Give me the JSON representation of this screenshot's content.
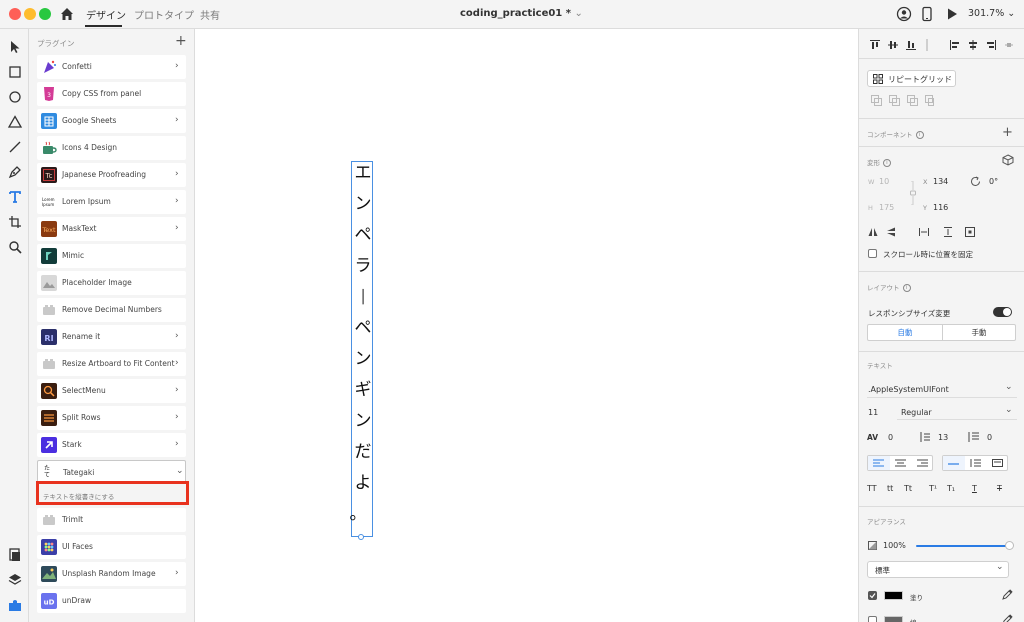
{
  "titlebar": {
    "tabs": [
      "デザイン",
      "プロトタイプ",
      "共有"
    ],
    "document_title": "coding_practice01 *",
    "zoom": "301.7%"
  },
  "plugins": {
    "header": "プラグイン",
    "items": [
      {
        "label": "Confetti",
        "icon": "confetti-icon",
        "color": "#6a3ccf",
        "chevron": true
      },
      {
        "label": "Copy CSS from panel",
        "icon": "css-icon",
        "color": "#d43b96",
        "chevron": false
      },
      {
        "label": "Google Sheets",
        "icon": "sheets-icon",
        "color": "#2f8be0",
        "chevron": true
      },
      {
        "label": "Icons 4 Design",
        "icon": "mug-icon",
        "color": "#3a8a6a",
        "chevron": false
      },
      {
        "label": "Japanese Proofreading",
        "icon": "tc-icon",
        "color": "#2a1a1a",
        "chevron": true
      },
      {
        "label": "Lorem Ipsum",
        "icon": "lorem-icon",
        "color": "#ffffff",
        "chevron": true
      },
      {
        "label": "MaskText",
        "icon": "masktext-icon",
        "color": "#8a3a10",
        "chevron": true
      },
      {
        "label": "Mimic",
        "icon": "mimic-icon",
        "color": "#123c3a",
        "chevron": false
      },
      {
        "label": "Placeholder Image",
        "icon": "placeholder-icon",
        "color": "#cfcfcf",
        "chevron": false
      },
      {
        "label": "Remove Decimal Numbers",
        "icon": "plugin-icon",
        "color": "#cfcfcf",
        "chevron": false
      },
      {
        "label": "Rename it",
        "icon": "renameit-icon",
        "color": "#2b2f6a",
        "chevron": true
      },
      {
        "label": "Resize Artboard to Fit Content",
        "icon": "plugin-icon",
        "color": "#cfcfcf",
        "chevron": true
      },
      {
        "label": "SelectMenu",
        "icon": "selectmenu-icon",
        "color": "#3a1e10",
        "chevron": true
      },
      {
        "label": "Split Rows",
        "icon": "splitrows-icon",
        "color": "#3a1e10",
        "chevron": true
      },
      {
        "label": "Stark",
        "icon": "stark-icon",
        "color": "#4a2ee0",
        "chevron": true
      },
      {
        "label": "Tategaki",
        "icon": "tategaki-icon",
        "color": "#ffffff",
        "chevron": true
      },
      {
        "label": "TrimIt",
        "icon": "plugin-icon",
        "color": "#cfcfcf",
        "chevron": false
      },
      {
        "label": "UI Faces",
        "icon": "uifaces-icon",
        "color": "#3b3fa8",
        "chevron": false
      },
      {
        "label": "Unsplash Random Image",
        "icon": "unsplash-icon",
        "color": "#2e4a5a",
        "chevron": true
      },
      {
        "label": "unDraw",
        "icon": "undraw-icon",
        "color": "#6a72ee",
        "chevron": false
      }
    ],
    "tategaki_icon_text": "たて",
    "submenu_label": "テキストを縦書きにする"
  },
  "canvas": {
    "vertical_text": [
      "エ",
      "ン",
      "ペ",
      "ラ",
      "ー",
      "ペ",
      "ン",
      "ギ",
      "ン",
      "だ",
      "よ",
      "。"
    ]
  },
  "properties": {
    "repeat_grid_label": "リピートグリッド",
    "component_label": "コンポーネント",
    "transform_label": "変形",
    "w_label": "W",
    "w_value": "10",
    "h_label": "H",
    "h_value": "175",
    "x_label": "X",
    "x_value": "134",
    "y_label": "Y",
    "y_value": "116",
    "rotation_value": "0°",
    "fix_scroll_label": "スクロール時に位置を固定",
    "layout_label": "レイアウト",
    "responsive_label": "レスポンシブサイズ変更",
    "auto_label": "自動",
    "manual_label": "手動",
    "text_section_label": "テキスト",
    "font_family": ".AppleSystemUIFont",
    "font_size": "11",
    "font_weight": "Regular",
    "char_spacing": "0",
    "line_spacing": "13",
    "para_spacing": "0",
    "text_styles": [
      "TT",
      "tt",
      "Tt",
      "T¹",
      "T₁",
      "T"
    ],
    "appearance_label": "アピアランス",
    "opacity": "100%",
    "blend_mode": "標準",
    "fill_label": "塗り",
    "fill_color": "#000000",
    "border_label": "線"
  }
}
